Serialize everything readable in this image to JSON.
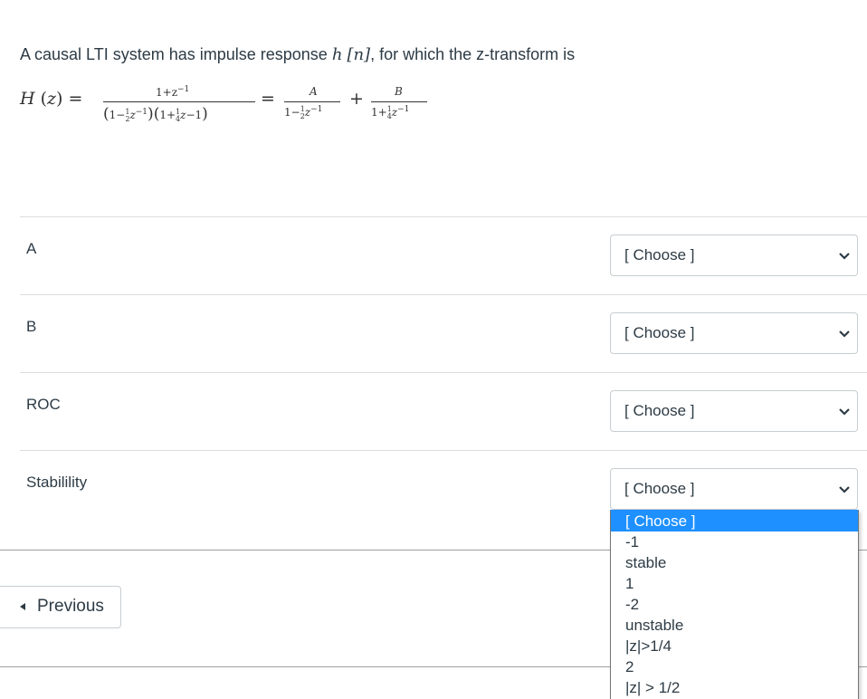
{
  "question": {
    "prefix": "A causal LTI system has impulse response ",
    "h_symbol": "h",
    "n_symbol": "[n]",
    "suffix": ", for which the z-transform is"
  },
  "equation": {
    "lhs": "H (z) =",
    "num1": "1+z",
    "num1_exp": "−1",
    "den1_part1": "(1−",
    "half_num": "1",
    "half_den": "2",
    "den1_z": "z",
    "den1_exp": "−1",
    "den1_mid": ")(1+",
    "quarter_num": "1",
    "quarter_den": "4",
    "den1_tail": "z−1)",
    "eq2": "=",
    "numA": "A",
    "denA_prefix": "1−",
    "denA_z": "z",
    "denA_exp": "−1",
    "plus": "+",
    "numB": "B",
    "denB_prefix": "1+",
    "denB_z": "z",
    "denB_exp": "−1"
  },
  "rows": [
    {
      "label": "A",
      "selected": "[ Choose ]"
    },
    {
      "label": "B",
      "selected": "[ Choose ]"
    },
    {
      "label": "ROC",
      "selected": "[ Choose ]"
    },
    {
      "label": "Stabilility",
      "selected": "[ Choose ]"
    }
  ],
  "dropdown": {
    "open_for": "Stabilility",
    "options": [
      "[ Choose ]",
      "-1",
      "stable",
      "1",
      "-2",
      "unstable",
      "|z|>1/4",
      "2",
      "|z| > 1/2"
    ],
    "highlighted_index": 0,
    "highlight_color": "#1e90ff"
  },
  "nav": {
    "previous_label": "Previous",
    "previous_icon": "caret-left-icon"
  }
}
